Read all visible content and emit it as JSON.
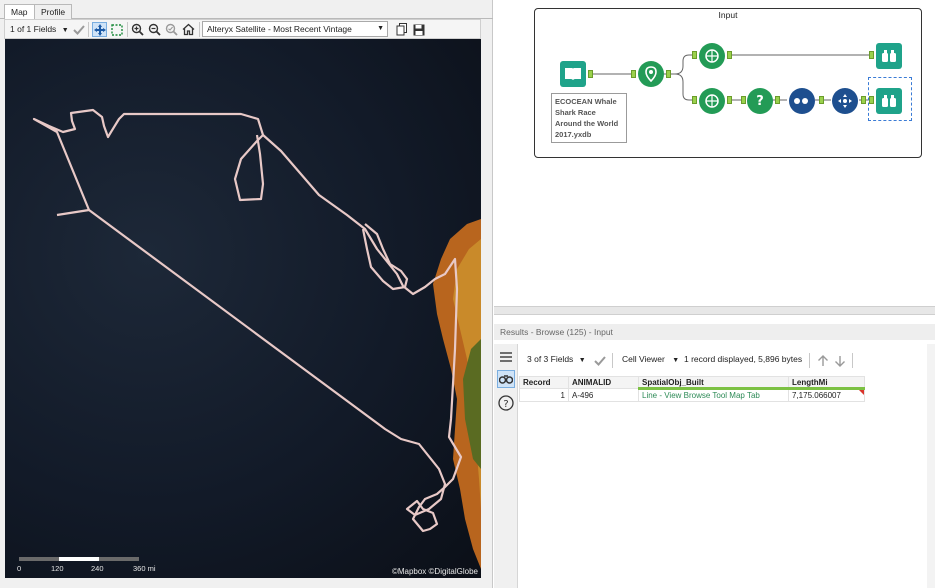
{
  "map_tabs": {
    "map": "Map",
    "profile": "Profile"
  },
  "map_toolbar": {
    "fields_select": "1 of 1 Fields",
    "basemap_select": "Alteryx Satellite - Most Recent Vintage"
  },
  "map": {
    "scale_labels": [
      "0",
      "120",
      "240",
      "360 mi"
    ],
    "attribution": "©Mapbox ©DigitalGlobe"
  },
  "workflow": {
    "container_title": "Input",
    "input_note": "ECOCEAN Whale Shark Race Around the World 2017.yxdb"
  },
  "results": {
    "title": "Results - Browse (125) - Input",
    "fields_select": "3 of 3 Fields",
    "viewer_select": "Cell Viewer",
    "status": "1 record displayed, 5,896 bytes",
    "columns": [
      "Record",
      "ANIMALID",
      "SpatialObj_Built",
      "LengthMi"
    ],
    "rows": [
      [
        "1",
        "A-496",
        "Line - View Browse Tool Map Tab",
        "7,175.066007"
      ]
    ]
  },
  "colors": {
    "tool_green": "#239b56",
    "browse_teal": "#1fa38a",
    "join_navy": "#1e4f8f",
    "anchor_green": "#9ad14c",
    "track_line": "#e8c9c7"
  }
}
